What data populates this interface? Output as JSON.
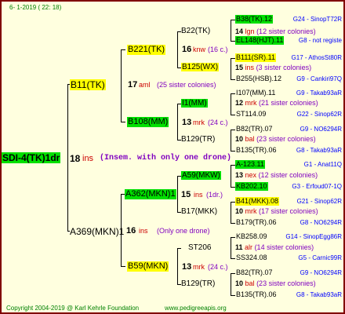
{
  "header": {
    "date": "6-  1-2019 ( 22: 18)"
  },
  "root": {
    "id": "SDI-4(TK)1dr",
    "year": "18",
    "breeder": "ins",
    "note": "(Insem. with only one drone)"
  },
  "g1": [
    {
      "id": "B11(TK)",
      "year": "17",
      "breeder": "aml",
      "note": "(25 sister colonies)"
    },
    {
      "id": "A369(MKN)1",
      "year": "16",
      "breeder": "ins",
      "note": "(Only one drone)"
    }
  ],
  "g2": [
    {
      "id": "B221(TK)",
      "year": "16",
      "breeder": "knw",
      "note": "(16 c.)"
    },
    {
      "id": "B108(MM)",
      "year": "13",
      "breeder": "mrk",
      "note": "(24 c.)"
    },
    {
      "id": "A362(MKN)1",
      "year": "15",
      "breeder": "ins",
      "note": "(1dr.)"
    },
    {
      "id": "B59(MKN)",
      "year": "13",
      "breeder": "mrk",
      "note": "(24 c.)"
    }
  ],
  "g3": [
    {
      "id": "B22(TK)",
      "year": "14",
      "breeder": "lgn",
      "note": "(12 sister colonies)"
    },
    {
      "id": "B125(WX)",
      "year": "15",
      "breeder": "ins",
      "note": "(3 sister colonies)"
    },
    {
      "id": "I1(MM)",
      "year": "12",
      "breeder": "mrk",
      "note": "(21 sister colonies)"
    },
    {
      "id": "B129(TR)",
      "year": "10",
      "breeder": "bal",
      "note": "(23 sister colonies)"
    },
    {
      "id": "A59(MKW)",
      "year": "13",
      "breeder": "nex",
      "note": "(12 sister colonies)"
    },
    {
      "id": "B17(MKK)",
      "year": "10",
      "breeder": "mrk",
      "note": "(17 sister colonies)"
    },
    {
      "id": "ST206",
      "year": "11",
      "breeder": "alr",
      "note": "(14 sister colonies)"
    },
    {
      "id": "B129(TR)",
      "year": "10",
      "breeder": "bal",
      "note": "(23 sister colonies)"
    }
  ],
  "g4": [
    {
      "id": "B38(TK).12",
      "hl": "green",
      "breeder": "G24 - SinopT72R"
    },
    {
      "id": "EL148(HJT).11",
      "hl": "green",
      "breeder": "G8 - not registe"
    },
    {
      "id": "B111(SR).11",
      "hl": "yellow",
      "breeder": "G17 - AthosSt80R"
    },
    {
      "id": "B255(HSB).12",
      "hl": "",
      "breeder": "G9 - Cankiri97Q"
    },
    {
      "id": "I107(MM).11",
      "hl": "",
      "breeder": "G9 - Takab93aR"
    },
    {
      "id": "ST114.09",
      "hl": "",
      "breeder": "G22 - Sinop62R"
    },
    {
      "id": "B82(TR).07",
      "hl": "",
      "breeder": "G9 - NO6294R"
    },
    {
      "id": "B135(TR).06",
      "hl": "",
      "breeder": "G8 - Takab93aR"
    },
    {
      "id": "A-123.11",
      "hl": "green",
      "breeder": "G1 - Anat11Q"
    },
    {
      "id": "KB202.10",
      "hl": "green",
      "breeder": "G3 - Erfoud07-1Q"
    },
    {
      "id": "B41(MKK).08",
      "hl": "yellow",
      "breeder": "G21 - Sinop62R"
    },
    {
      "id": "B179(TR).06",
      "hl": "",
      "breeder": "G8 - NO6294R"
    },
    {
      "id": "KB258.09",
      "hl": "",
      "breeder": "G14 - SinopEgg86R"
    },
    {
      "id": "SS324.08",
      "hl": "",
      "breeder": "G5 - Carnic99R"
    },
    {
      "id": "B82(TR).07",
      "hl": "",
      "breeder": "G9 - NO6294R"
    },
    {
      "id": "B135(TR).06",
      "hl": "",
      "breeder": "G8 - Takab93aR"
    }
  ],
  "footer": {
    "copyright": "Copyright 2004-2019 @ Karl Kehrle Foundation",
    "website": "www.pedigreeapis.org"
  }
}
